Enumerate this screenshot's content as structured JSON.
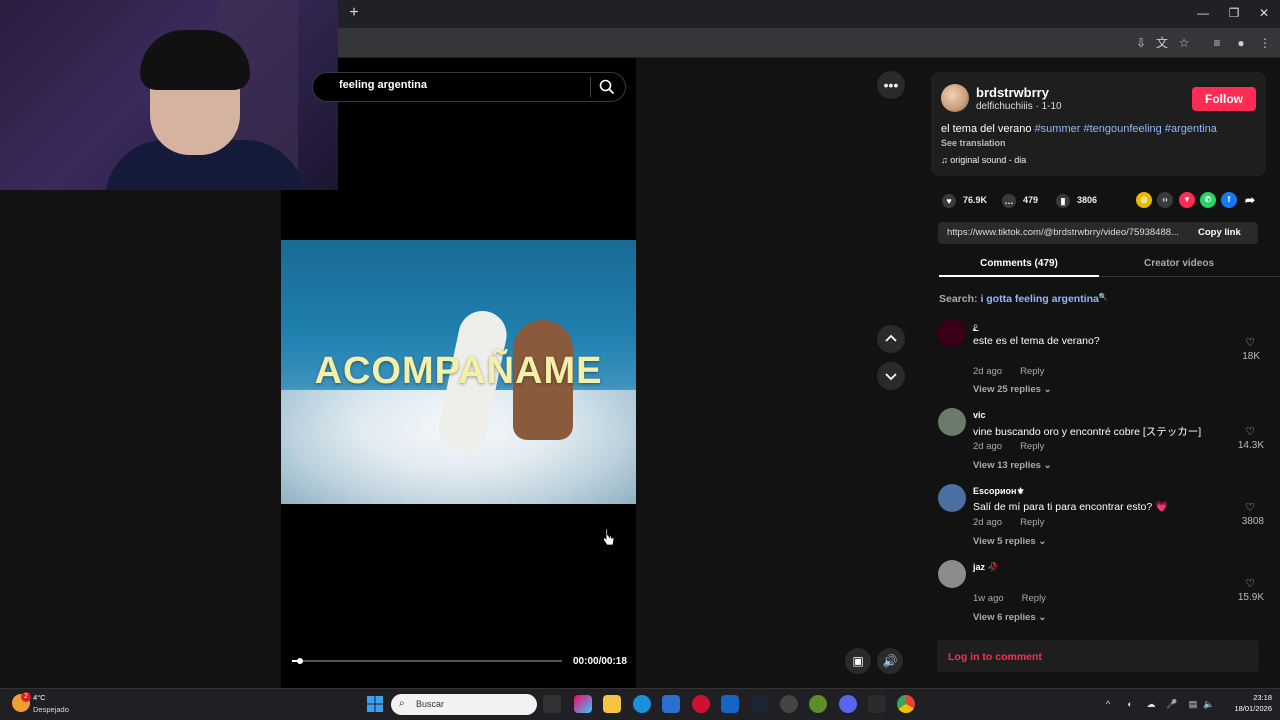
{
  "search": {
    "query": "feeling argentina"
  },
  "video": {
    "caption": "ACOMPAÑAME",
    "timecode": "00:00/00:18",
    "progress_fraction": 0.03
  },
  "author": {
    "username": "brdstrwbrry",
    "subline": "delfichuchiiis · 1-10",
    "follow_label": "Follow"
  },
  "description": {
    "text": "el tema del verano",
    "tags": [
      "#summer",
      "#tengounfeeling",
      "#argentina"
    ],
    "see_translation": "See translation",
    "sound": "original sound - dia"
  },
  "actions": {
    "likes": "76.9K",
    "comments": "479",
    "saves": "3806"
  },
  "share_icons": [
    "coin-icon",
    "embed-icon",
    "send-icon",
    "whatsapp-icon",
    "facebook-icon",
    "share-arrow-icon"
  ],
  "link": {
    "url": "https://www.tiktok.com/@brdstrwbrry/video/75938488...",
    "copy_label": "Copy link"
  },
  "tabs": {
    "comments": "Comments (479)",
    "creator": "Creator videos"
  },
  "search_suggestion": {
    "prefix": "Search: ",
    "query": "i gotta feeling argentina",
    "icon": "search-icon"
  },
  "comments": [
    {
      "name": "ౖ",
      "text": "este es el tema de verano?",
      "time": "2d ago",
      "reply": "Reply",
      "replies": "View 25 replies",
      "likes": "18K",
      "avatar_color": "#3a0018"
    },
    {
      "name": "vic",
      "text": "vine buscando oro y encontré cobre [ステッカー]",
      "time": "2d ago",
      "reply": "Reply",
      "replies": "View 13 replies",
      "likes": "14.3K",
      "avatar_color": "#6b7a6a"
    },
    {
      "name": "Escорион⚜",
      "text": "Salí de mí para ti para encontrar esto? 💗",
      "time": "2d ago",
      "reply": "Reply",
      "replies": "View 5 replies",
      "likes": "3808",
      "avatar_color": "#4a6fa0"
    },
    {
      "name": "jaz 🥀",
      "text": "",
      "time": "1w ago",
      "reply": "Reply",
      "replies": "View 6 replies",
      "likes": "15.9K",
      "avatar_color": "#8c8c8c"
    }
  ],
  "login": {
    "label": "Log in to comment"
  },
  "taskbar": {
    "temp": "4°C",
    "weather": "Despejado",
    "badge": "2",
    "search_placeholder": "Buscar",
    "time": "23:18",
    "date": "18/01/2026"
  },
  "colors": {
    "accent": "#fe2c55",
    "tag": "#8fb8ff",
    "background": "#121212"
  }
}
